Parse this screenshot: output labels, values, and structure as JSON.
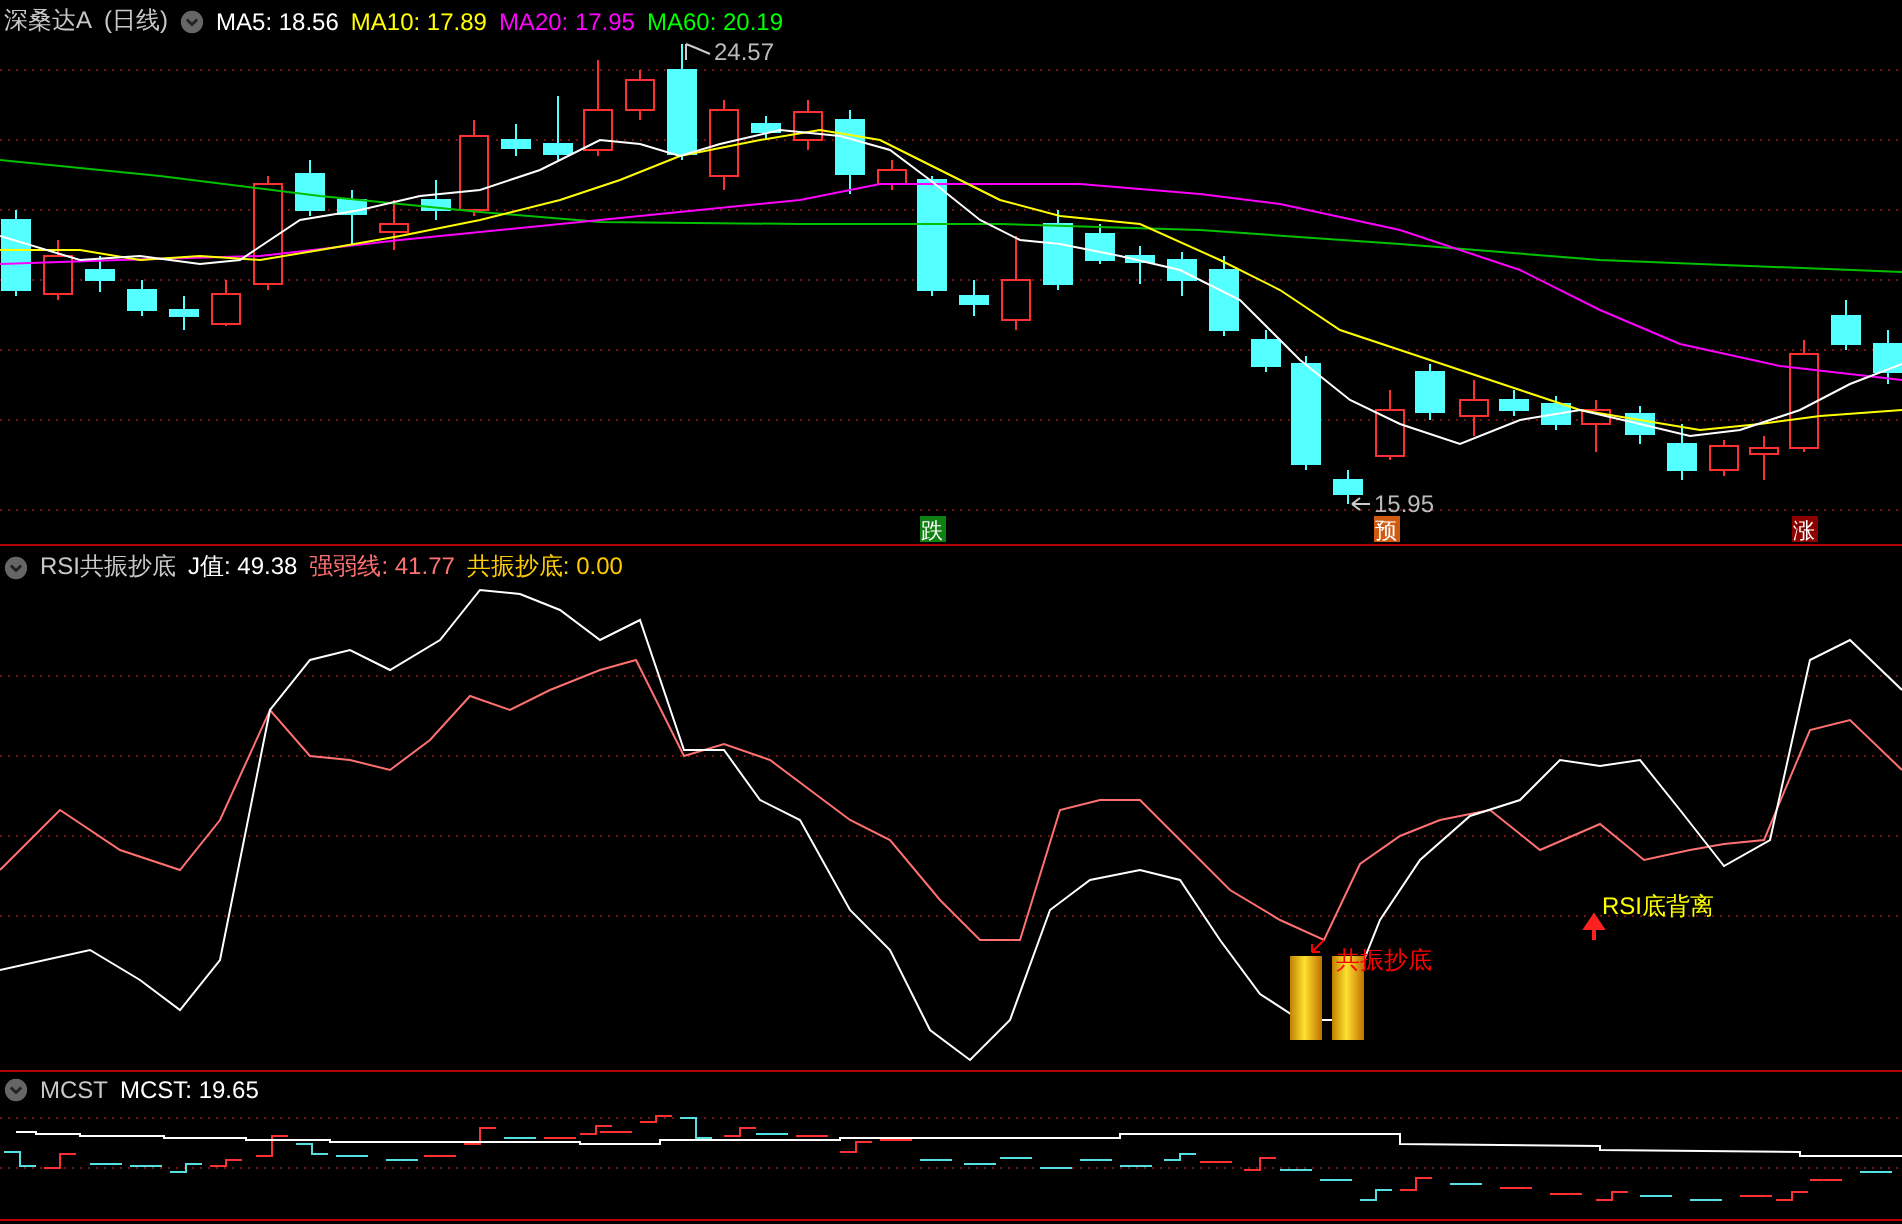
{
  "main_panel": {
    "title": "深桑达A",
    "period": "(日线)",
    "indicators": [
      {
        "label": "MA5:",
        "value": "18.56",
        "color": "#ffffff"
      },
      {
        "label": "MA10:",
        "value": "17.89",
        "color": "#ffff00"
      },
      {
        "label": "MA20:",
        "value": "17.95",
        "color": "#ff00ff"
      },
      {
        "label": "MA60:",
        "value": "20.19",
        "color": "#00ff00"
      }
    ],
    "price_labels": [
      {
        "text": "24.57"
      },
      {
        "text": "15.95"
      }
    ],
    "signals": [
      {
        "text": "跌",
        "color": "#108010"
      },
      {
        "text": "预",
        "color": "#d05a10"
      },
      {
        "text": "涨",
        "color": "#8c0000"
      }
    ]
  },
  "rsi_panel": {
    "title": "RSI共振抄底",
    "indicators": [
      {
        "label": "J值:",
        "value": "49.38",
        "color": "#ffffff"
      },
      {
        "label": "强弱线:",
        "value": "41.77",
        "color": "#ff7070"
      },
      {
        "label": "共振抄底:",
        "value": "0.00",
        "color": "#ffcc00"
      }
    ],
    "annotations": [
      {
        "text": "共振抄底",
        "color": "#ff0000"
      },
      {
        "text": "RSI底背离",
        "color": "#ffff00"
      }
    ]
  },
  "mcst_panel": {
    "title": "MCST",
    "indicators": [
      {
        "label": "MCST:",
        "value": "19.65",
        "color": "#ffffff"
      }
    ]
  }
}
